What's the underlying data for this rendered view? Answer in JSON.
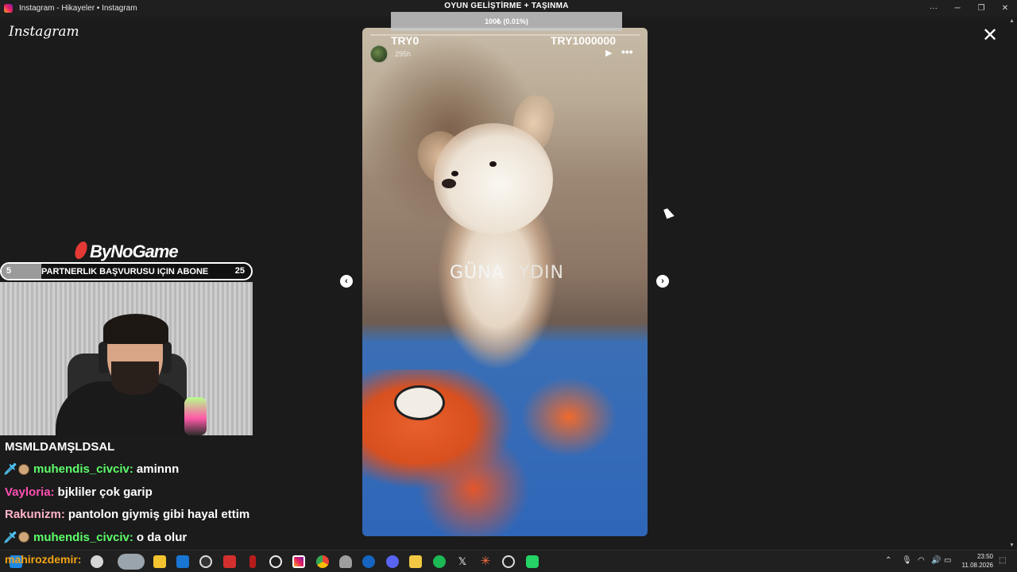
{
  "window": {
    "title": "Instagram - Hikayeler • Instagram",
    "logo_text": "Instagram",
    "close_label": "✕"
  },
  "stream_overlay": {
    "goal_title": "OYUN GELİŞTİRME + TAŞINMA",
    "goal_progress_text": "100₺ (0.01%)",
    "goal_progress": 0.0001,
    "try_left": "TRY0",
    "try_right": "TRY1000000",
    "brand": "ByNoGame",
    "sub_goal": {
      "left_value": "5",
      "text": "PARTNERLIK BAŞVURUSU IÇIN ABONE",
      "right_value": "25"
    }
  },
  "story": {
    "username": ".",
    "time_ago": "295h",
    "caption_part1": "GÜNA",
    "caption_part2": "YDIN",
    "play_icon": "play-icon",
    "more_icon": "more-icon"
  },
  "navigation": {
    "prev_icon": "chevron-left-icon",
    "next_icon": "chevron-right-icon"
  },
  "chat": {
    "header": "MSMLDAMŞLDSAL",
    "messages": [
      {
        "user": "muhendis_civciv:",
        "text": "aminnn",
        "user_color": "#5dff6a",
        "badges": true
      },
      {
        "user": "Vayloria:",
        "text": "bjkliler çok garip",
        "user_color": "#ff4fb3",
        "badges": false
      },
      {
        "user": "Rakunizm:",
        "text": "pantolon giymiş gibi hayal ettim",
        "user_color": "#ffb3c8",
        "badges": false
      },
      {
        "user": "muhendis_civciv:",
        "text": "o da olur",
        "user_color": "#5dff6a",
        "badges": true
      }
    ],
    "partial_user": "mahirozdemir:"
  },
  "taskbar": {
    "time": "23:50",
    "date": "11.08.2026",
    "pinned_icons": [
      "folder-icon",
      "mail-icon",
      "speedometer-icon",
      "red-x-icon",
      "netflix-icon",
      "chatgpt-icon",
      "instagram-icon",
      "chrome-icon",
      "ghost-icon",
      "steam-icon",
      "discord-icon",
      "map-icon",
      "spotify-icon",
      "x-icon",
      "asterisk-icon",
      "circle-icon",
      "whatsapp-icon"
    ]
  }
}
